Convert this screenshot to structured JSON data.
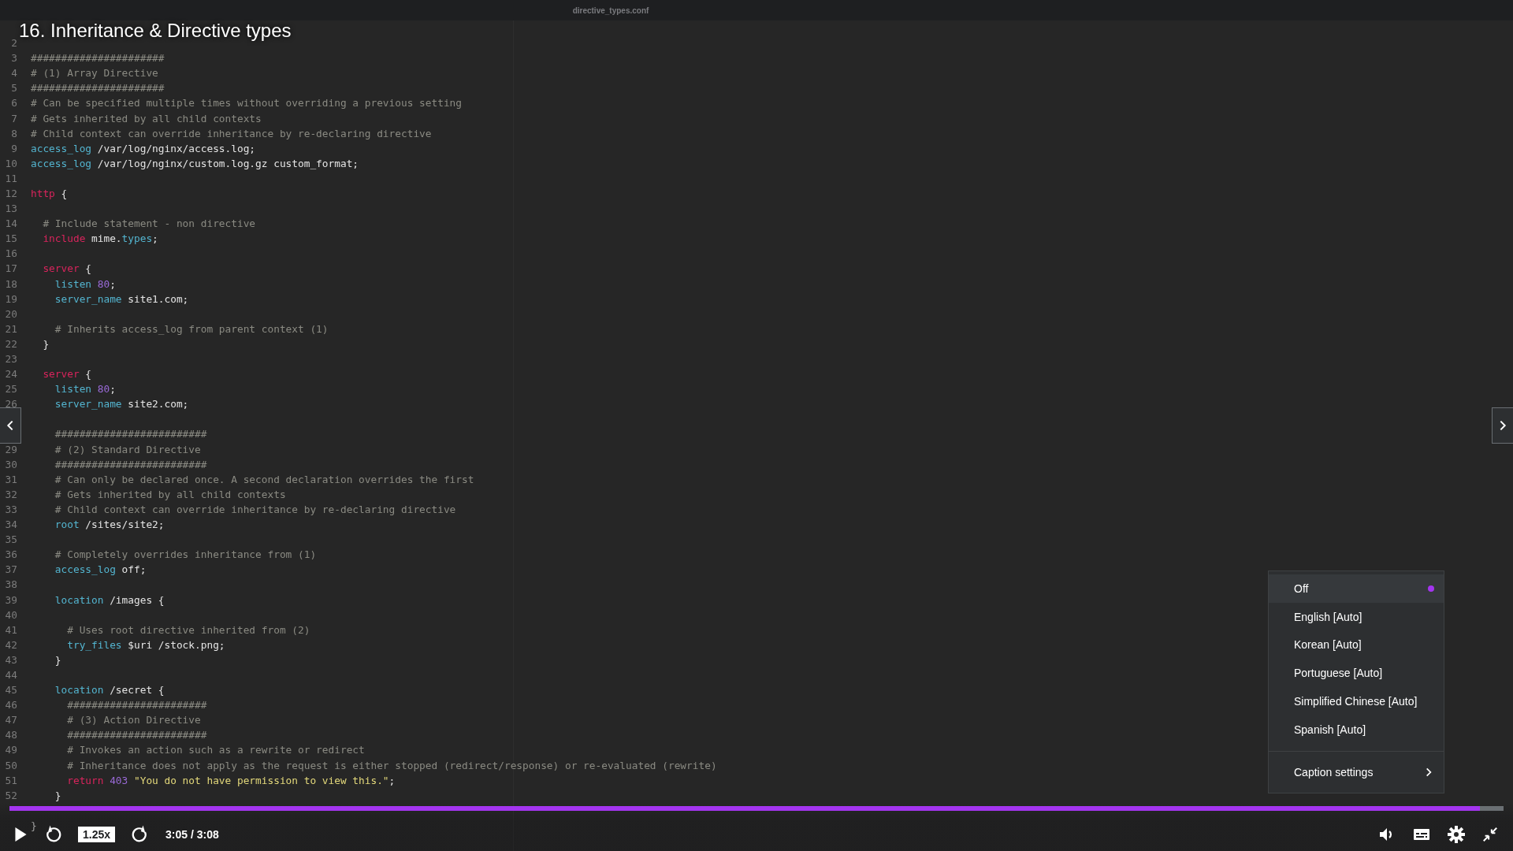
{
  "lecture_title": "16. Inheritance & Directive types",
  "editor": {
    "file_tab": "directive_types.conf",
    "lines": [
      {
        "kind": "blank",
        "number": "2"
      },
      {
        "kind": "code",
        "number": "3",
        "tokens": [
          {
            "kind": "comment",
            "text": "######################"
          }
        ]
      },
      {
        "kind": "code",
        "number": "4",
        "tokens": [
          {
            "kind": "comment",
            "text": "# (1) Array Directive"
          }
        ]
      },
      {
        "kind": "code",
        "number": "5",
        "tokens": [
          {
            "kind": "comment",
            "text": "######################"
          }
        ]
      },
      {
        "kind": "code",
        "number": "6",
        "tokens": [
          {
            "kind": "comment",
            "text": "# Can be specified multiple times without overriding a previous setting"
          }
        ]
      },
      {
        "kind": "code",
        "number": "7",
        "tokens": [
          {
            "kind": "comment",
            "text": "# Gets inherited by all child contexts"
          }
        ]
      },
      {
        "kind": "code",
        "number": "8",
        "tokens": [
          {
            "kind": "comment",
            "text": "# Child context can override inheritance by re-declaring directive"
          }
        ]
      },
      {
        "kind": "code",
        "number": "9",
        "tokens": [
          {
            "kind": "directive",
            "text": "access_log"
          },
          {
            "kind": "plain",
            "text": " /var/log/nginx/access.log;"
          }
        ]
      },
      {
        "kind": "code",
        "number": "10",
        "tokens": [
          {
            "kind": "directive",
            "text": "access_log"
          },
          {
            "kind": "plain",
            "text": " /var/log/nginx/custom.log.gz custom_format;"
          }
        ]
      },
      {
        "kind": "blank",
        "number": "11"
      },
      {
        "kind": "code",
        "number": "12",
        "tokens": [
          {
            "kind": "keyword",
            "text": "http"
          },
          {
            "kind": "plain",
            "text": " {"
          }
        ]
      },
      {
        "kind": "blank",
        "number": "13"
      },
      {
        "kind": "code",
        "number": "14",
        "tokens": [
          {
            "kind": "comment",
            "text": "  # Include statement - non directive"
          }
        ]
      },
      {
        "kind": "code",
        "number": "15",
        "tokens": [
          {
            "kind": "keyword",
            "text": "  include"
          },
          {
            "kind": "plain",
            "text": " mime."
          },
          {
            "kind": "directive",
            "text": "types"
          },
          {
            "kind": "plain",
            "text": ";"
          }
        ]
      },
      {
        "kind": "blank",
        "number": "16"
      },
      {
        "kind": "code",
        "number": "17",
        "tokens": [
          {
            "kind": "keyword",
            "text": "  server"
          },
          {
            "kind": "plain",
            "text": " {"
          }
        ]
      },
      {
        "kind": "code",
        "number": "18",
        "tokens": [
          {
            "kind": "directive",
            "text": "    listen"
          },
          {
            "kind": "number",
            "text": " 80"
          },
          {
            "kind": "plain",
            "text": ";"
          }
        ]
      },
      {
        "kind": "code",
        "number": "19",
        "tokens": [
          {
            "kind": "directive",
            "text": "    server_name"
          },
          {
            "kind": "plain",
            "text": " site1.com;"
          }
        ]
      },
      {
        "kind": "blank",
        "number": "20"
      },
      {
        "kind": "code",
        "number": "21",
        "tokens": [
          {
            "kind": "comment",
            "text": "    # Inherits access_log from parent context (1)"
          }
        ]
      },
      {
        "kind": "code",
        "number": "22",
        "tokens": [
          {
            "kind": "plain",
            "text": "  }"
          }
        ]
      },
      {
        "kind": "blank",
        "number": "23"
      },
      {
        "kind": "code",
        "number": "24",
        "tokens": [
          {
            "kind": "keyword",
            "text": "  server"
          },
          {
            "kind": "plain",
            "text": " {"
          }
        ]
      },
      {
        "kind": "code",
        "number": "25",
        "tokens": [
          {
            "kind": "directive",
            "text": "    listen"
          },
          {
            "kind": "number",
            "text": " 80"
          },
          {
            "kind": "plain",
            "text": ";"
          }
        ]
      },
      {
        "kind": "code",
        "number": "26",
        "tokens": [
          {
            "kind": "directive",
            "text": "    server_name"
          },
          {
            "kind": "plain",
            "text": " site2.com;"
          }
        ]
      },
      {
        "kind": "blank"
      },
      {
        "kind": "code",
        "tokens": [
          {
            "kind": "comment",
            "text": "    #########################"
          }
        ]
      },
      {
        "kind": "code",
        "number": "29",
        "tokens": [
          {
            "kind": "comment",
            "text": "    # (2) Standard Directive"
          }
        ]
      },
      {
        "kind": "code",
        "number": "30",
        "tokens": [
          {
            "kind": "comment",
            "text": "    #########################"
          }
        ]
      },
      {
        "kind": "code",
        "number": "31",
        "tokens": [
          {
            "kind": "comment",
            "text": "    # Can only be declared once. A second declaration overrides the first"
          }
        ]
      },
      {
        "kind": "code",
        "number": "32",
        "tokens": [
          {
            "kind": "comment",
            "text": "    # Gets inherited by all child contexts"
          }
        ]
      },
      {
        "kind": "code",
        "number": "33",
        "tokens": [
          {
            "kind": "comment",
            "text": "    # Child context can override inheritance by re-declaring directive"
          }
        ]
      },
      {
        "kind": "code",
        "number": "34",
        "tokens": [
          {
            "kind": "directive",
            "text": "    root"
          },
          {
            "kind": "plain",
            "text": " /sites/site2;"
          }
        ]
      },
      {
        "kind": "blank",
        "number": "35"
      },
      {
        "kind": "code",
        "number": "36",
        "tokens": [
          {
            "kind": "comment",
            "text": "    # Completely overrides inheritance from (1)"
          }
        ]
      },
      {
        "kind": "code",
        "number": "37",
        "tokens": [
          {
            "kind": "directive",
            "text": "    access_log"
          },
          {
            "kind": "plain",
            "text": " off;"
          }
        ]
      },
      {
        "kind": "blank",
        "number": "38"
      },
      {
        "kind": "code",
        "number": "39",
        "tokens": [
          {
            "kind": "directive",
            "text": "    location"
          },
          {
            "kind": "plain",
            "text": " /images {"
          }
        ]
      },
      {
        "kind": "blank",
        "number": "40"
      },
      {
        "kind": "code",
        "number": "41",
        "tokens": [
          {
            "kind": "comment",
            "text": "      # Uses root directive inherited from (2)"
          }
        ]
      },
      {
        "kind": "code",
        "number": "42",
        "tokens": [
          {
            "kind": "directive",
            "text": "      try_files"
          },
          {
            "kind": "plain",
            "text": " $uri /stock.png;"
          }
        ]
      },
      {
        "kind": "code",
        "number": "43",
        "tokens": [
          {
            "kind": "plain",
            "text": "    }"
          }
        ]
      },
      {
        "kind": "blank",
        "number": "44"
      },
      {
        "kind": "code",
        "number": "45",
        "tokens": [
          {
            "kind": "directive",
            "text": "    location"
          },
          {
            "kind": "plain",
            "text": " /secret {"
          }
        ]
      },
      {
        "kind": "code",
        "number": "46",
        "tokens": [
          {
            "kind": "comment",
            "text": "      #######################"
          }
        ]
      },
      {
        "kind": "code",
        "number": "47",
        "tokens": [
          {
            "kind": "comment",
            "text": "      # (3) Action Directive"
          }
        ]
      },
      {
        "kind": "code",
        "number": "48",
        "tokens": [
          {
            "kind": "comment",
            "text": "      #######################"
          }
        ]
      },
      {
        "kind": "code",
        "number": "49",
        "tokens": [
          {
            "kind": "comment",
            "text": "      # Invokes an action such as a rewrite or redirect"
          }
        ]
      },
      {
        "kind": "code",
        "number": "50",
        "tokens": [
          {
            "kind": "comment",
            "text": "      # Inheritance does not apply as the request is either stopped (redirect/response) or re-evaluated (rewrite)"
          }
        ]
      },
      {
        "kind": "code",
        "number": "51",
        "tokens": [
          {
            "kind": "keyword",
            "text": "      return"
          },
          {
            "kind": "number",
            "text": " 403"
          },
          {
            "kind": "string",
            "text": " \"You do not have permission to view this.\""
          },
          {
            "kind": "plain",
            "text": ";"
          }
        ]
      },
      {
        "kind": "code",
        "number": "52",
        "tokens": [
          {
            "kind": "plain",
            "text": "    }"
          }
        ]
      },
      {
        "kind": "blank"
      },
      {
        "kind": "code",
        "tokens": [
          {
            "kind": "plain",
            "text": "}"
          }
        ]
      }
    ]
  },
  "progress": {
    "level": 0.984
  },
  "controls": {
    "speed": "1.25x",
    "time": "3:05 / 3:08"
  },
  "captions_menu": {
    "items": [
      {
        "label": "Off",
        "selected": true
      },
      {
        "label": "English [Auto]",
        "selected": false
      },
      {
        "label": "Korean [Auto]",
        "selected": false
      },
      {
        "label": "Portuguese [Auto]",
        "selected": false
      },
      {
        "label": "Simplified Chinese [Auto]",
        "selected": false
      },
      {
        "label": "Spanish [Auto]",
        "selected": false
      }
    ],
    "settings_label": "Caption settings"
  }
}
